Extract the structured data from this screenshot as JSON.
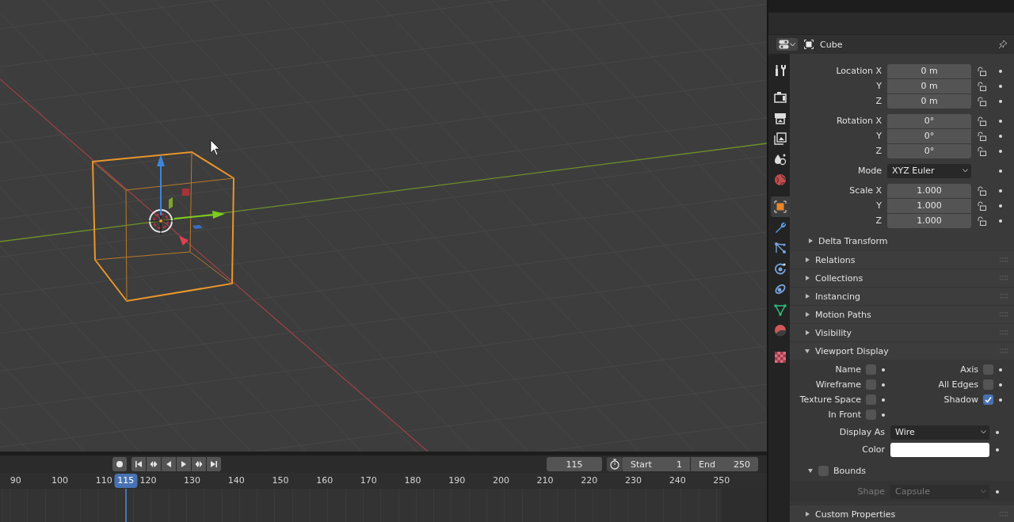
{
  "properties_header": {
    "object_name": "Cube"
  },
  "tabs": [
    {
      "kind": "tool",
      "selected": false
    },
    {
      "kind": "render",
      "selected": false
    },
    {
      "kind": "output",
      "selected": false
    },
    {
      "kind": "view_layer",
      "selected": false
    },
    {
      "kind": "scene",
      "selected": false
    },
    {
      "kind": "world",
      "selected": false
    },
    {
      "kind": "object",
      "selected": true
    },
    {
      "kind": "modifier",
      "selected": false
    },
    {
      "kind": "particles",
      "selected": false
    },
    {
      "kind": "physics",
      "selected": false
    },
    {
      "kind": "constraints",
      "selected": false
    },
    {
      "kind": "data",
      "selected": false
    },
    {
      "kind": "material",
      "selected": false
    },
    {
      "kind": "texture",
      "selected": false
    }
  ],
  "transform": {
    "location": [
      {
        "label": "Location X",
        "value": "0 m"
      },
      {
        "label": "Y",
        "value": "0 m"
      },
      {
        "label": "Z",
        "value": "0 m"
      }
    ],
    "rotation": [
      {
        "label": "Rotation X",
        "value": "0°"
      },
      {
        "label": "Y",
        "value": "0°"
      },
      {
        "label": "Z",
        "value": "0°"
      }
    ],
    "mode": {
      "label": "Mode",
      "value": "XYZ Euler"
    },
    "scale": [
      {
        "label": "Scale X",
        "value": "1.000"
      },
      {
        "label": "Y",
        "value": "1.000"
      },
      {
        "label": "Z",
        "value": "1.000"
      }
    ]
  },
  "subpanels": [
    {
      "label": "Delta Transform",
      "expanded": false
    }
  ],
  "panels": [
    {
      "label": "Relations",
      "expanded": false
    },
    {
      "label": "Collections",
      "expanded": false
    },
    {
      "label": "Instancing",
      "expanded": false
    },
    {
      "label": "Motion Paths",
      "expanded": false
    },
    {
      "label": "Visibility",
      "expanded": false
    },
    {
      "label": "Viewport Display",
      "expanded": true,
      "content": {
        "options": [
          {
            "label": "Name",
            "checked": false
          },
          {
            "label": "Axis",
            "checked": false
          },
          {
            "label": "Wireframe",
            "checked": false
          },
          {
            "label": "All Edges",
            "checked": false
          },
          {
            "label": "Texture Space",
            "checked": false
          },
          {
            "label": "Shadow",
            "checked": true
          },
          {
            "label": "In Front",
            "checked": false
          }
        ],
        "display_as": {
          "label": "Display As",
          "value": "Wire"
        },
        "color": {
          "label": "Color",
          "color": "#ffffff"
        },
        "bounds": {
          "label": "Bounds",
          "checked": false,
          "expanded": true,
          "shape": {
            "label": "Shape",
            "value": "Capsule",
            "disabled": true
          }
        }
      }
    },
    {
      "label": "Custom Properties",
      "expanded": false
    }
  ],
  "timeline": {
    "current_frame": "115",
    "start": {
      "label": "Start",
      "value": "1"
    },
    "end": {
      "label": "End",
      "value": "250"
    },
    "frames": [
      "90",
      "100",
      "110",
      "120",
      "130",
      "140",
      "150",
      "160",
      "170",
      "180",
      "190",
      "200",
      "210",
      "220",
      "230",
      "240",
      "250"
    ],
    "playhead": {
      "label": "115",
      "level": 0.164
    }
  }
}
